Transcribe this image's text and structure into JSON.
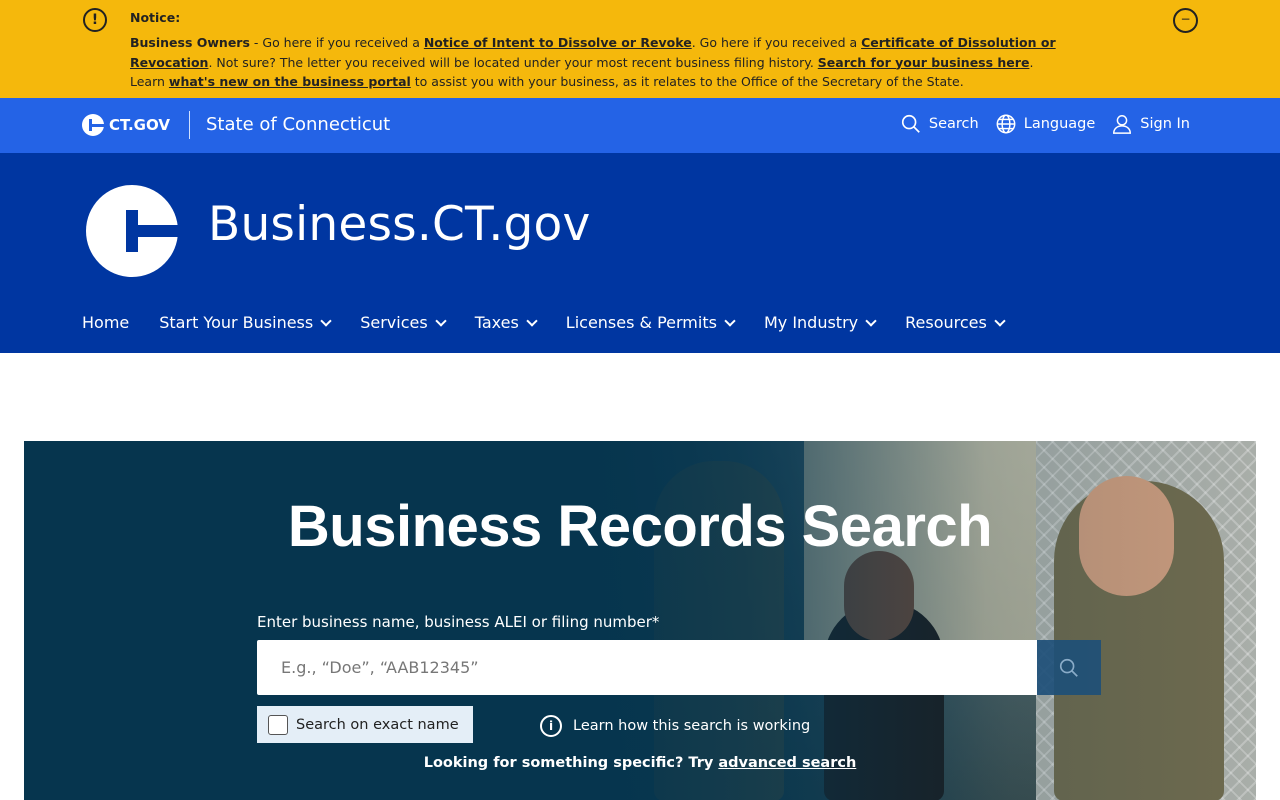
{
  "notice": {
    "icon": "exclamation-circle-icon",
    "title": "Notice:",
    "lead_bold": "Business Owners",
    "text1": " - Go here if you received a ",
    "link1": "Notice of Intent to Dissolve or Revoke",
    "text2": ". Go here if you received a ",
    "link2": "Certificate of Dissolution or Revocation",
    "text3": ". Not sure? The letter you received will be located under your most recent business filing history. ",
    "link3": "Search for your business here",
    "text4": ".",
    "text5": "Learn ",
    "link4": "what's new on the business portal",
    "text6": " to assist you with your business, as it relates to the Office of the Secretary of the State.",
    "close_glyph": "−"
  },
  "utility": {
    "logo_text": "CT.GOV",
    "state_name": "State of Connecticut",
    "search_label": "Search",
    "language_label": "Language",
    "signin_label": "Sign In"
  },
  "header": {
    "site_title": "Business.CT.gov",
    "nav": [
      {
        "label": "Home"
      },
      {
        "label": "Start Your Business"
      },
      {
        "label": "Services"
      },
      {
        "label": "Taxes"
      },
      {
        "label": "Licenses & Permits"
      },
      {
        "label": "My Industry"
      },
      {
        "label": "Resources"
      }
    ]
  },
  "hero": {
    "title": "Business Records Search",
    "search_label": "Enter business name, business ALEI or filing number*",
    "search_placeholder": "E.g., “Doe”, “AAB12345”",
    "search_value": "",
    "exact_label": "Search on exact name",
    "learn_label": "Learn how this search is working",
    "specific_text": "Looking for something specific? Try ",
    "advanced_link": "advanced search"
  },
  "colors": {
    "notice_bg": "#f5b80c",
    "utility_bg": "#2463e6",
    "header_bg": "#0036a1",
    "hero_bg": "#06354e"
  }
}
